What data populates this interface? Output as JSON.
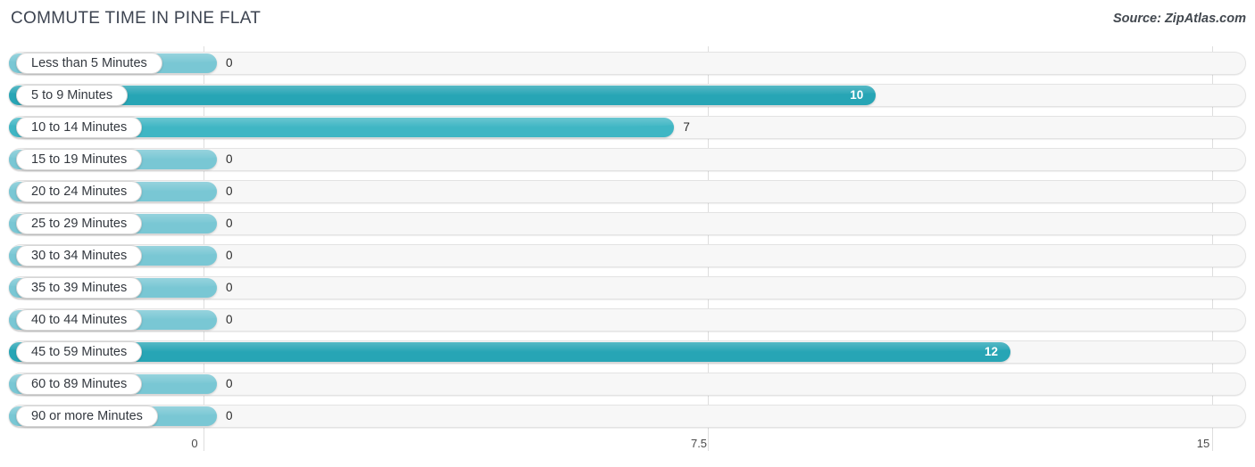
{
  "header": {
    "title": "COMMUTE TIME IN PINE FLAT",
    "source": "Source: ZipAtlas.com"
  },
  "colors": {
    "bar_high": "#27A5B5",
    "bar_mid": "#3FB6C4",
    "bar_low": "#79C7D4",
    "track": "#f7f7f7",
    "grid": "#dedede",
    "text": "#33383f"
  },
  "chart_data": {
    "type": "bar",
    "orientation": "horizontal",
    "title": "COMMUTE TIME IN PINE FLAT",
    "xlabel": "",
    "ylabel": "",
    "xlim": [
      0,
      15
    ],
    "ticks": [
      "0",
      "7.5",
      "15"
    ],
    "tick_values": [
      0,
      7.5,
      15
    ],
    "grid": true,
    "legend": "none",
    "categories": [
      "Less than 5 Minutes",
      "5 to 9 Minutes",
      "10 to 14 Minutes",
      "15 to 19 Minutes",
      "20 to 24 Minutes",
      "25 to 29 Minutes",
      "30 to 34 Minutes",
      "35 to 39 Minutes",
      "40 to 44 Minutes",
      "45 to 59 Minutes",
      "60 to 89 Minutes",
      "90 or more Minutes"
    ],
    "values": [
      0,
      10,
      7,
      0,
      0,
      0,
      0,
      0,
      0,
      12,
      0,
      0
    ],
    "value_labels": [
      "0",
      "10",
      "7",
      "0",
      "0",
      "0",
      "0",
      "0",
      "0",
      "12",
      "0",
      "0"
    ]
  },
  "rows": [
    {
      "label": "Less than 5 Minutes",
      "value": 0,
      "value_label": "0",
      "inside": false
    },
    {
      "label": "5 to 9 Minutes",
      "value": 10,
      "value_label": "10",
      "inside": true
    },
    {
      "label": "10 to 14 Minutes",
      "value": 7,
      "value_label": "7",
      "inside": false
    },
    {
      "label": "15 to 19 Minutes",
      "value": 0,
      "value_label": "0",
      "inside": false
    },
    {
      "label": "20 to 24 Minutes",
      "value": 0,
      "value_label": "0",
      "inside": false
    },
    {
      "label": "25 to 29 Minutes",
      "value": 0,
      "value_label": "0",
      "inside": false
    },
    {
      "label": "30 to 34 Minutes",
      "value": 0,
      "value_label": "0",
      "inside": false
    },
    {
      "label": "35 to 39 Minutes",
      "value": 0,
      "value_label": "0",
      "inside": false
    },
    {
      "label": "40 to 44 Minutes",
      "value": 0,
      "value_label": "0",
      "inside": false
    },
    {
      "label": "45 to 59 Minutes",
      "value": 12,
      "value_label": "12",
      "inside": true
    },
    {
      "label": "60 to 89 Minutes",
      "value": 0,
      "value_label": "0",
      "inside": false
    },
    {
      "label": "90 or more Minutes",
      "value": 0,
      "value_label": "0",
      "inside": false
    }
  ]
}
